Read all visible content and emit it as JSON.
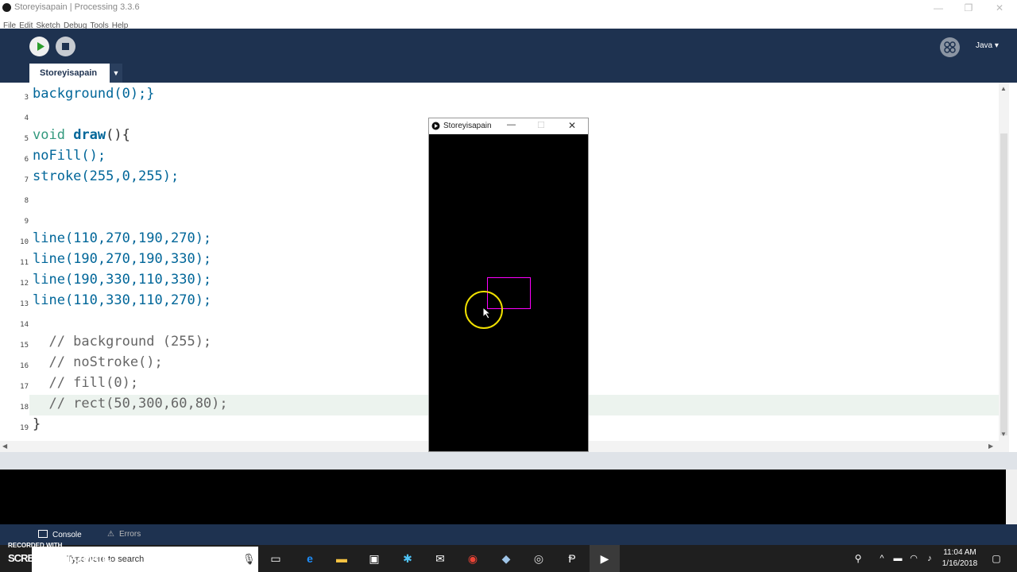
{
  "window": {
    "title": "Storeyisapain | Processing 3.3.6"
  },
  "menu": [
    "File",
    "Edit",
    "Sketch",
    "Debug",
    "Tools",
    "Help"
  ],
  "toolbar": {
    "mode": "Java",
    "mode_arrow": "▾"
  },
  "tab": {
    "label": "Storeyisapain",
    "menu_arrow": "▼"
  },
  "editor": {
    "lines": [
      {
        "n": "3",
        "text": "background(0);}"
      },
      {
        "n": "4",
        "text": ""
      },
      {
        "n": "5",
        "text": "void draw(){"
      },
      {
        "n": "6",
        "text": "noFill();"
      },
      {
        "n": "7",
        "text": "stroke(255,0,255);"
      },
      {
        "n": "8",
        "text": ""
      },
      {
        "n": "9",
        "text": ""
      },
      {
        "n": "10",
        "text": "line(110,270,190,270);"
      },
      {
        "n": "11",
        "text": "line(190,270,190,330);"
      },
      {
        "n": "12",
        "text": "line(190,330,110,330);"
      },
      {
        "n": "13",
        "text": "line(110,330,110,270);"
      },
      {
        "n": "14",
        "text": ""
      },
      {
        "n": "15",
        "text": "  // background (255);"
      },
      {
        "n": "16",
        "text": "  // noStroke();"
      },
      {
        "n": "17",
        "text": "  // fill(0);"
      },
      {
        "n": "18",
        "text": "  // rect(50,300,60,80);"
      },
      {
        "n": "19",
        "text": "}"
      }
    ]
  },
  "sketch_window": {
    "title": "Storeyisapain",
    "rect_color": "#ff00ff"
  },
  "console_tabs": {
    "console": "Console",
    "errors": "Errors"
  },
  "taskbar": {
    "search_placeholder": "Type here to search",
    "time": "11:04 AM",
    "date": "1/16/2018",
    "recorded_with": "RECORDED WITH",
    "recorder": "SCREENCAST-O-MATIC"
  },
  "colors": {
    "toolbar": "#1e3250",
    "keyword": "#33997e",
    "function": "#006699",
    "highlight_line": "#ecf3ee"
  }
}
